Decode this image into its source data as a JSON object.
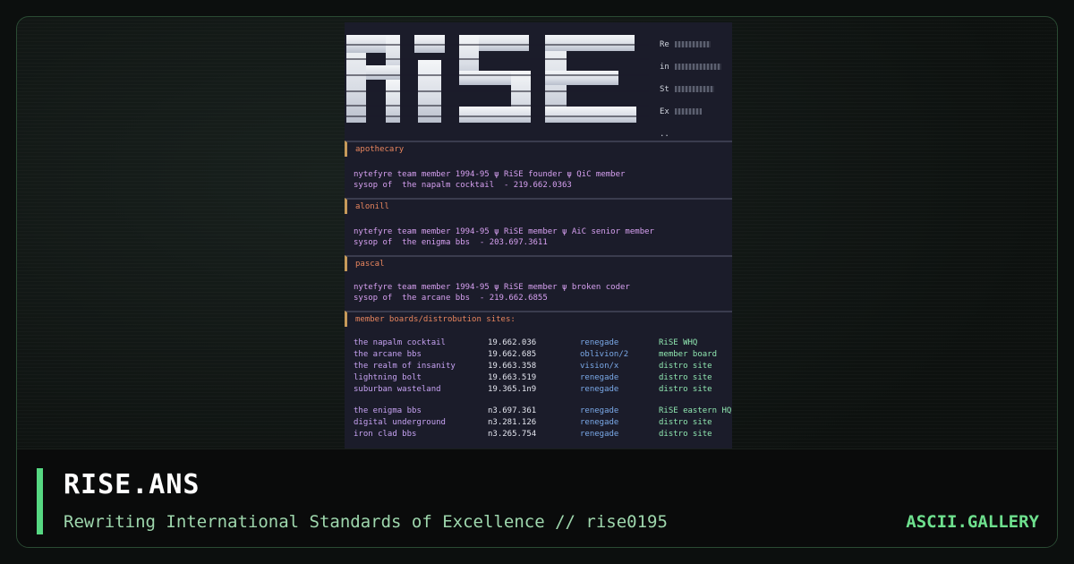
{
  "artwork": {
    "side_labels": [
      "Re",
      "in",
      "St",
      "Ex",
      ".."
    ],
    "members": [
      {
        "handle": "apothecary",
        "lines": [
          "nytefyre team member 1994-95 ψ RiSE founder ψ QiC member",
          "sysop of  the napalm cocktail  - 219.662.0363"
        ]
      },
      {
        "handle": "alonill",
        "lines": [
          "nytefyre team member 1994-95 ψ RiSE member ψ AiC senior member",
          "sysop of  the enigma bbs  - 203.697.3611"
        ]
      },
      {
        "handle": "pascal",
        "lines": [
          "nytefyre team member 1994-95 ψ RiSE member ψ broken coder",
          "sysop of  the arcane bbs  - 219.662.6855"
        ]
      }
    ],
    "boards_header": "member boards/distrobution sites:",
    "boards_group1": [
      [
        "the napalm cocktail",
        "19.662.036",
        "renegade",
        "RiSE WHQ"
      ],
      [
        "the arcane bbs",
        "19.662.685",
        "oblivion/2",
        "member board"
      ],
      [
        "the realm of insanity",
        "19.663.358",
        "vision/x",
        "distro site"
      ],
      [
        "lightning bolt",
        "19.663.519",
        "renegade",
        "distro site"
      ],
      [
        "suburban wasteland",
        "19.365.1n9",
        "renegade",
        "distro site"
      ]
    ],
    "boards_group2": [
      [
        "the enigma bbs",
        "n3.697.361",
        "renegade",
        "RiSE eastern HQ"
      ],
      [
        "digital underground",
        "n3.281.126",
        "renegade",
        "distro site"
      ],
      [
        "iron clad bbs",
        "n3.265.754",
        "renegade",
        "distro site"
      ]
    ]
  },
  "info": {
    "title": "RISE.ANS",
    "subtitle": "Rewriting International Standards of Excellence // rise0195",
    "brand": "ASCII.GALLERY"
  },
  "colors": {
    "accent": "#56d882",
    "art_background": "#1b1c2a",
    "handle": "#e8855e",
    "text_purple": "#d6a0f0"
  }
}
